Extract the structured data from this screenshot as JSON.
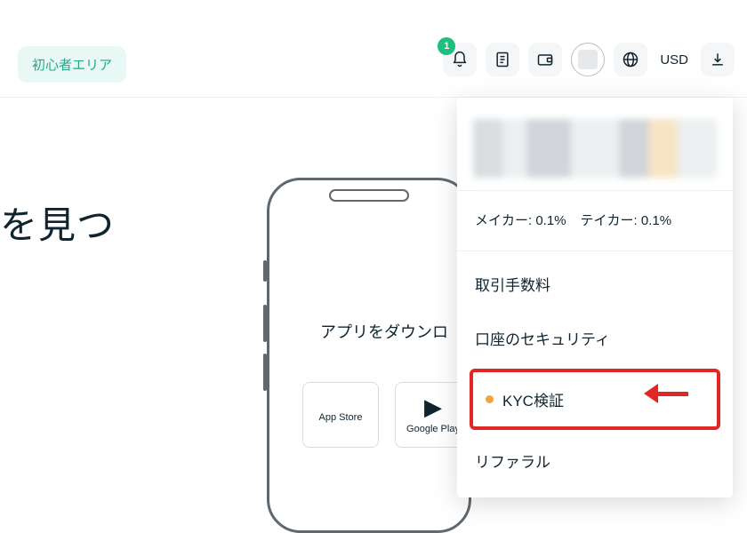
{
  "topbar": {
    "beginner_label": "初心者エリア",
    "notification_count": "1",
    "currency": "USD"
  },
  "hero": {
    "partial_text": "を見つ"
  },
  "download": {
    "label": "アプリをダウンロ",
    "app_store": "App Store",
    "google_play": "Google Play"
  },
  "dropdown": {
    "fees_maker_label": "メイカー:",
    "fees_maker_value": "0.1%",
    "fees_taker_label": "テイカー:",
    "fees_taker_value": "0.1%",
    "items": [
      {
        "label": "取引手数料"
      },
      {
        "label": "口座のセキュリティ"
      },
      {
        "label": "KYC検証"
      },
      {
        "label": "リファラル"
      }
    ]
  }
}
